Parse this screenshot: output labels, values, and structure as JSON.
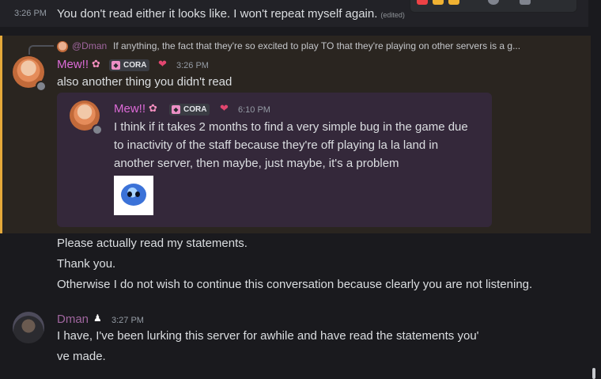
{
  "top_message": {
    "timestamp": "3:26 PM",
    "text": "You don't read either it looks like. I won't repeat myself again.",
    "edited_label": "(edited)"
  },
  "highlighted_message": {
    "reply": {
      "author": "@Dman",
      "text": "If anything, the fact that they're so excited to play TO that they're playing on other servers is a g..."
    },
    "author": "Mew!!",
    "flower_icon": "cherry-blossom-icon",
    "tag": "CORA",
    "heart_icon": "heart-icon",
    "timestamp": "3:26 PM",
    "text": "also another thing you didn't read",
    "quoted": {
      "author": "Mew!!",
      "tag": "CORA",
      "timestamp": "6:10 PM",
      "text": "I think if it takes 2 months to find a very simple bug in the game due to inactivity of the staff because they're off playing la la land in another server, then maybe, just maybe, it's a problem",
      "attachment_icon": "blue-blob-emoji-icon"
    }
  },
  "followups": [
    "Please actually read my statements.",
    "Thank you.",
    "Otherwise I do not wish to continue this conversation because clearly you are not listening."
  ],
  "dman_message": {
    "author": "Dman",
    "badge_icon": "penguin-icon",
    "timestamp": "3:27 PM",
    "line1": "I have, I've been lurking this server for awhile and have read the statements you'",
    "line2": "ve made."
  },
  "colors": {
    "mew_name": "#dd6bd8",
    "dman_name": "#a0669f",
    "highlight_bar": "#e5a93a"
  }
}
